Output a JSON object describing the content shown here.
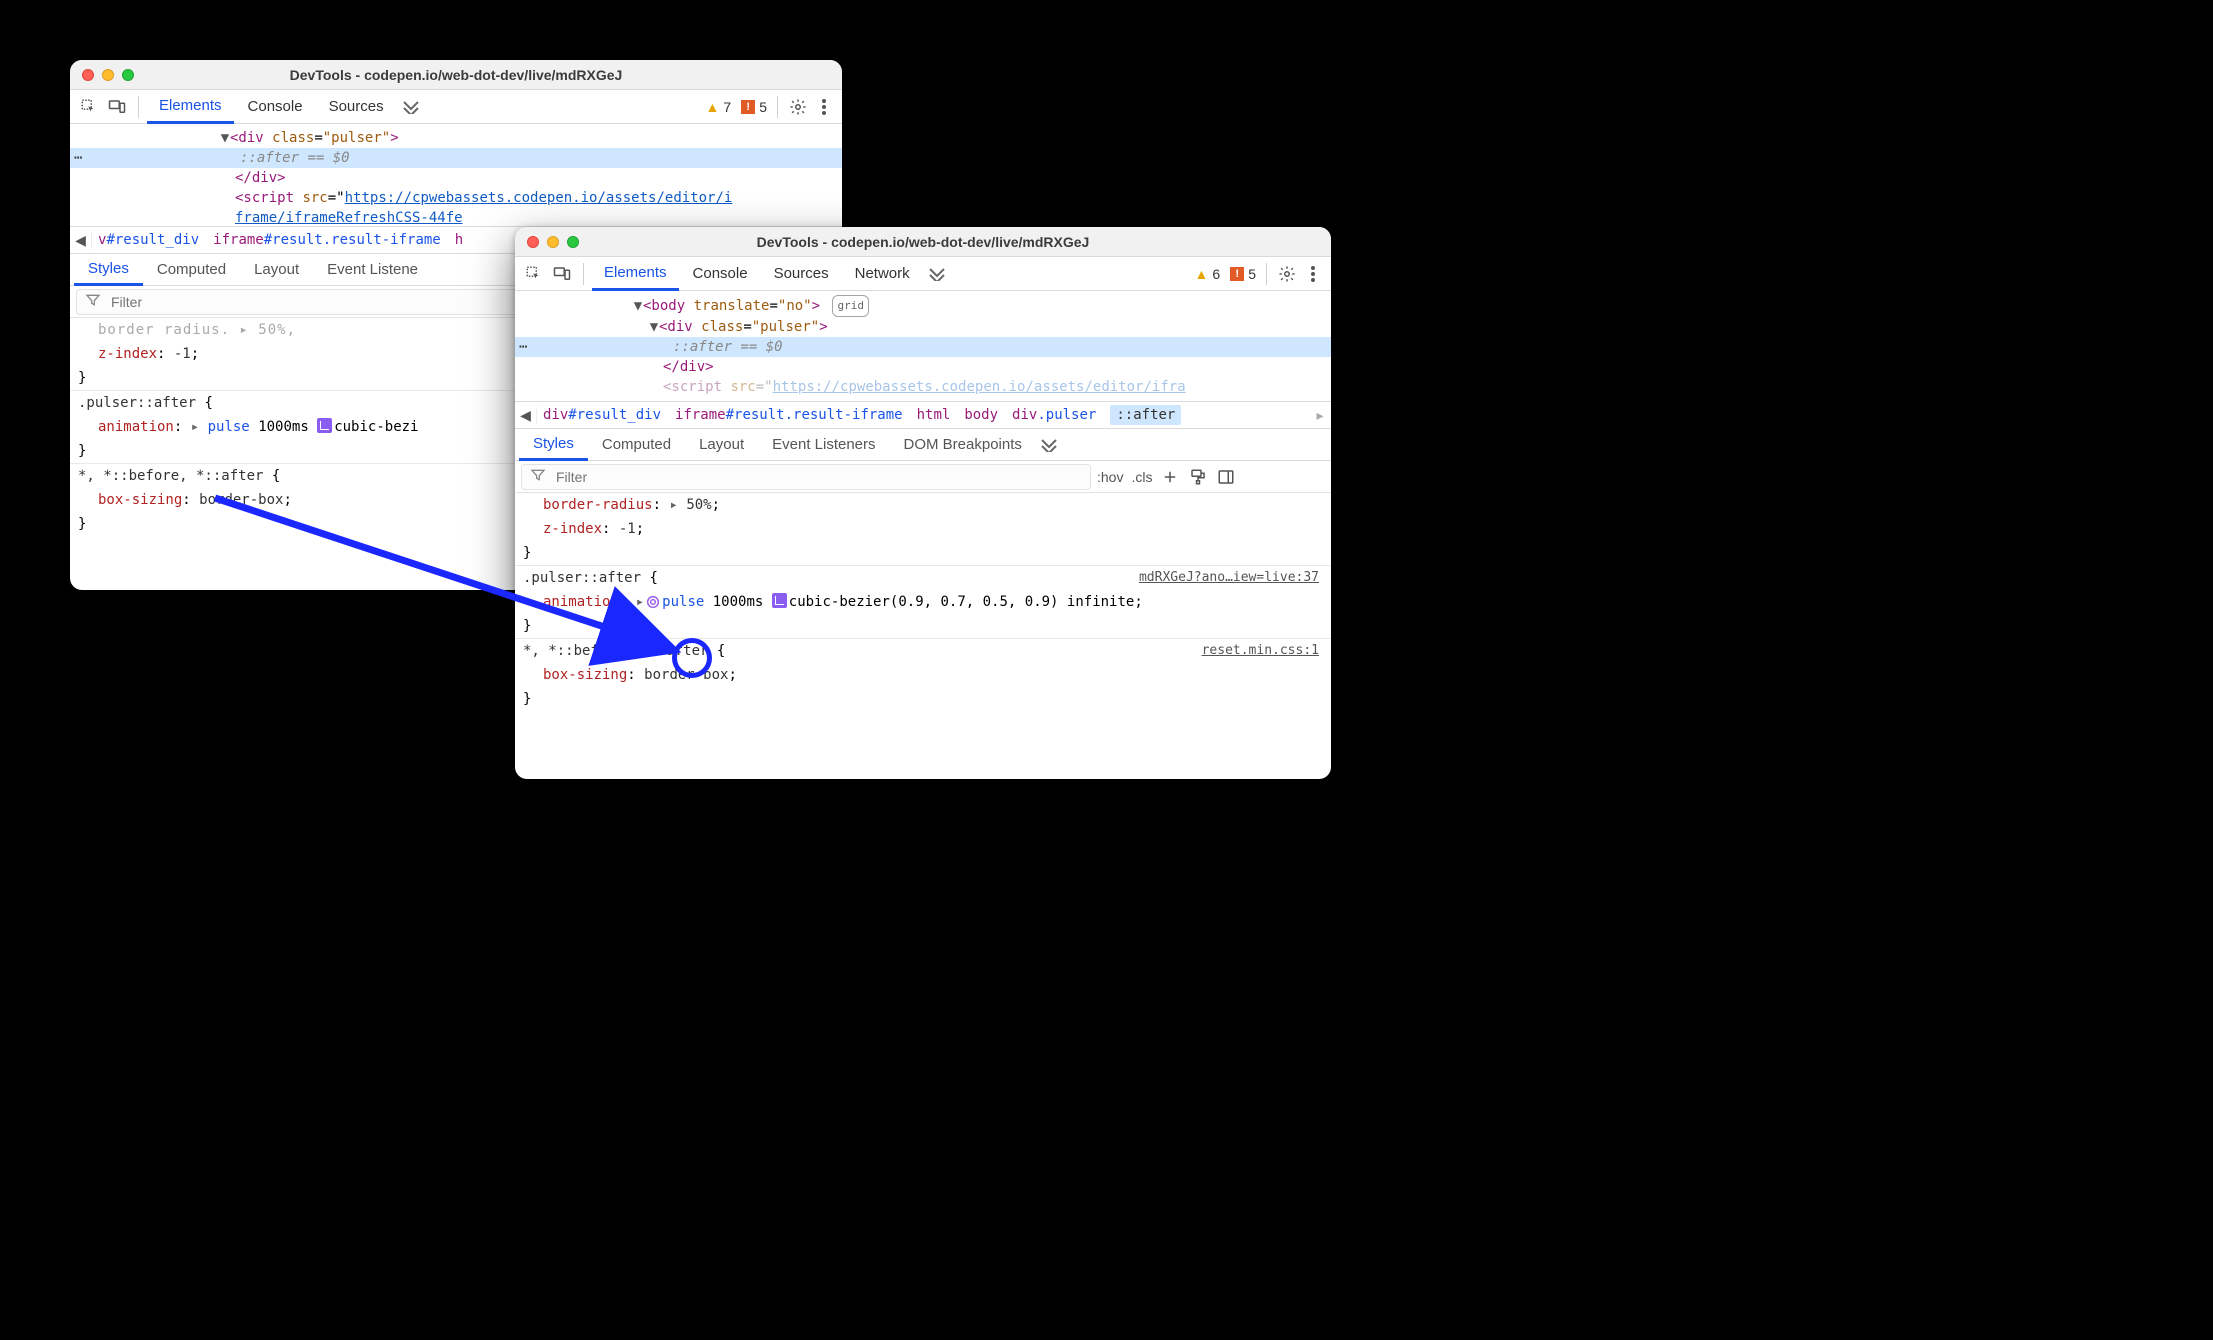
{
  "window_title": "DevTools - codepen.io/web-dot-dev/live/mdRXGeJ",
  "tabs": {
    "elements": "Elements",
    "console": "Console",
    "sources": "Sources",
    "network": "Network"
  },
  "counts": {
    "warn1": "7",
    "err1": "5",
    "warn2": "6",
    "err2": "5"
  },
  "dom": {
    "body_open": "<body translate=\"no\">",
    "grid_badge": "grid",
    "div_open": "<div class=\"pulser\">",
    "after_line": "::after",
    "eq0": " == $0",
    "div_close": "</div>",
    "script_prefix": "<script src=\"",
    "script_url_top": "https://cpwebassets.codepen.io/assets/editor/i",
    "script_url_top2": "frame/iframeRefreshCSS-44fe",
    "script_url2": "https://cpwebassets.codepen.io/assets/editor/ifra"
  },
  "crumb": {
    "result_div": "v#result_div",
    "result_div_full": "div#result_div",
    "iframe": "iframe#result.result-iframe",
    "html": "html",
    "body": "body",
    "pulser": "div.pulser",
    "after": "::after",
    "h": "h"
  },
  "subtabs": {
    "styles": "Styles",
    "computed": "Computed",
    "layout": "Layout",
    "listeners_short": "Event Listene",
    "listeners": "Event Listeners",
    "dom_bp": "DOM Breakpoints"
  },
  "filter_placeholder": "Filter",
  "filter_tools": {
    "hov": ":hov",
    "cls": ".cls"
  },
  "css": {
    "border_radius": "border-radius",
    "border_radius_v": "50%",
    "z_index": "z-index",
    "z_index_v": "-1",
    "rule2_sel": ".pulser::after",
    "animation": "animation",
    "pulse": "pulse",
    "ms": "1000ms",
    "bezier_part": "cubic-bezi",
    "bezier_full": "cubic-bezier(0.9, 0.7, 0.5, 0.9) infinite",
    "universal_sel": "*, *::before, *::after",
    "box_sizing": "box-sizing",
    "box_sizing_v": "border-box",
    "src2": "mdRXGeJ?ano…iew=live:37",
    "src3": "reset.min.css:1",
    "frag_top": "border-radius: ▸ 50%;"
  }
}
